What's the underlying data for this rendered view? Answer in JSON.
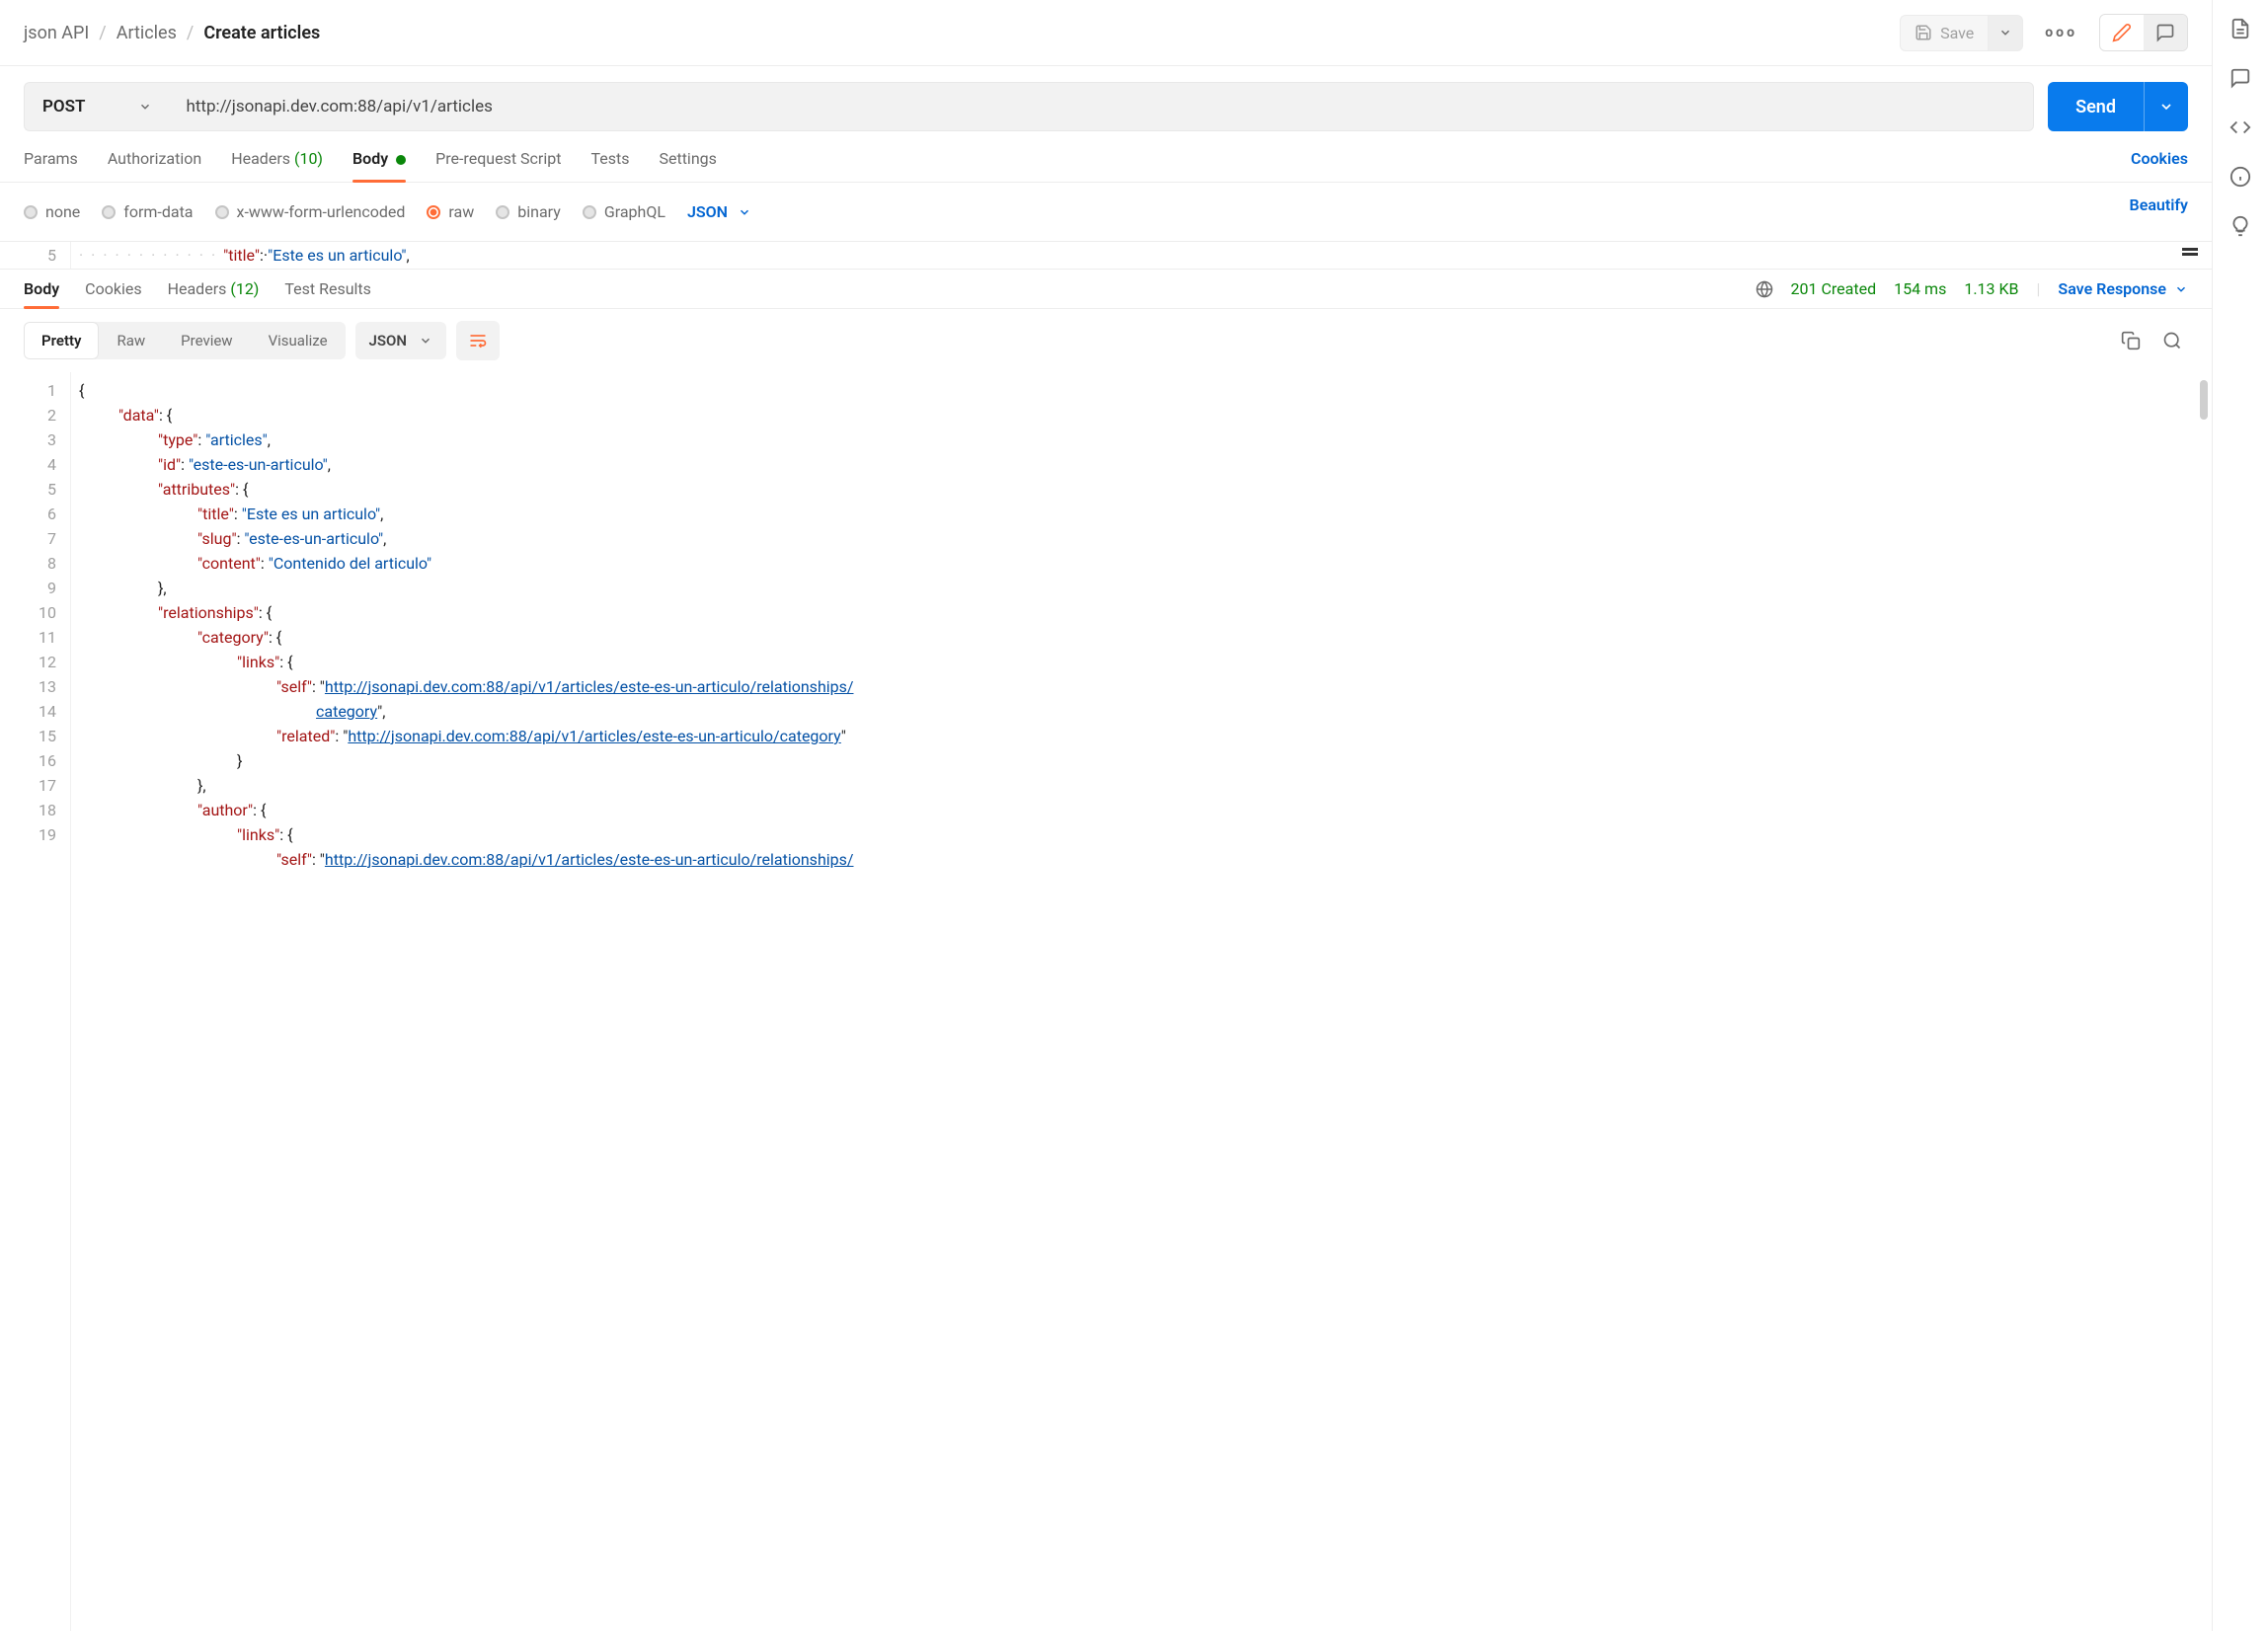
{
  "breadcrumbs": {
    "root": "json API",
    "mid": "Articles",
    "current": "Create articles"
  },
  "topbar": {
    "save": "Save",
    "more": "ooo"
  },
  "request": {
    "method": "POST",
    "url": "http://jsonapi.dev.com:88/api/v1/articles",
    "send": "Send"
  },
  "reqTabs": {
    "params": "Params",
    "auth": "Authorization",
    "headers": "Headers",
    "headersCount": "(10)",
    "body": "Body",
    "prereq": "Pre-request Script",
    "tests": "Tests",
    "settings": "Settings",
    "cookies": "Cookies"
  },
  "bodyTypes": {
    "none": "none",
    "formdata": "form-data",
    "urlenc": "x-www-form-urlencoded",
    "raw": "raw",
    "binary": "binary",
    "graphql": "GraphQL",
    "format": "JSON",
    "beautify": "Beautify"
  },
  "reqEditor": {
    "lineNo": "5",
    "key": "\"title\"",
    "val": "\"Este es un articulo\""
  },
  "respTabs": {
    "body": "Body",
    "cookies": "Cookies",
    "headers": "Headers",
    "headersCount": "(12)",
    "testResults": "Test Results"
  },
  "respMeta": {
    "status": "201 Created",
    "time": "154 ms",
    "size": "1.13 KB",
    "save": "Save Response"
  },
  "viewModes": {
    "pretty": "Pretty",
    "raw": "Raw",
    "preview": "Preview",
    "visualize": "Visualize",
    "format": "JSON"
  },
  "responseLines": [
    {
      "n": "1",
      "pad": 0,
      "tok": [
        {
          "t": "p",
          "v": "{"
        }
      ]
    },
    {
      "n": "2",
      "pad": 1,
      "tok": [
        {
          "t": "k",
          "v": "\"data\""
        },
        {
          "t": "p",
          "v": ": {"
        }
      ]
    },
    {
      "n": "3",
      "pad": 2,
      "tok": [
        {
          "t": "k",
          "v": "\"type\""
        },
        {
          "t": "p",
          "v": ": "
        },
        {
          "t": "s",
          "v": "\"articles\""
        },
        {
          "t": "p",
          "v": ","
        }
      ]
    },
    {
      "n": "4",
      "pad": 2,
      "tok": [
        {
          "t": "k",
          "v": "\"id\""
        },
        {
          "t": "p",
          "v": ": "
        },
        {
          "t": "s",
          "v": "\"este-es-un-articulo\""
        },
        {
          "t": "p",
          "v": ","
        }
      ]
    },
    {
      "n": "5",
      "pad": 2,
      "tok": [
        {
          "t": "k",
          "v": "\"attributes\""
        },
        {
          "t": "p",
          "v": ": {"
        }
      ]
    },
    {
      "n": "6",
      "pad": 3,
      "tok": [
        {
          "t": "k",
          "v": "\"title\""
        },
        {
          "t": "p",
          "v": ": "
        },
        {
          "t": "s",
          "v": "\"Este es un articulo\""
        },
        {
          "t": "p",
          "v": ","
        }
      ]
    },
    {
      "n": "7",
      "pad": 3,
      "tok": [
        {
          "t": "k",
          "v": "\"slug\""
        },
        {
          "t": "p",
          "v": ": "
        },
        {
          "t": "s",
          "v": "\"este-es-un-articulo\""
        },
        {
          "t": "p",
          "v": ","
        }
      ]
    },
    {
      "n": "8",
      "pad": 3,
      "tok": [
        {
          "t": "k",
          "v": "\"content\""
        },
        {
          "t": "p",
          "v": ": "
        },
        {
          "t": "s",
          "v": "\"Contenido del articulo\""
        }
      ]
    },
    {
      "n": "9",
      "pad": 2,
      "tok": [
        {
          "t": "p",
          "v": "},"
        }
      ]
    },
    {
      "n": "10",
      "pad": 2,
      "tok": [
        {
          "t": "k",
          "v": "\"relationships\""
        },
        {
          "t": "p",
          "v": ": {"
        }
      ]
    },
    {
      "n": "11",
      "pad": 3,
      "tok": [
        {
          "t": "k",
          "v": "\"category\""
        },
        {
          "t": "p",
          "v": ": {"
        }
      ]
    },
    {
      "n": "12",
      "pad": 4,
      "tok": [
        {
          "t": "k",
          "v": "\"links\""
        },
        {
          "t": "p",
          "v": ": {"
        }
      ]
    },
    {
      "n": "13",
      "pad": 5,
      "tok": [
        {
          "t": "k",
          "v": "\"self\""
        },
        {
          "t": "p",
          "v": ": \""
        },
        {
          "t": "l",
          "v": "http://jsonapi.dev.com:88/api/v1/articles/este-es-un-articulo/relationships/"
        }
      ]
    },
    {
      "n": "",
      "pad": 6,
      "tok": [
        {
          "t": "l",
          "v": "category"
        },
        {
          "t": "p",
          "v": "\","
        }
      ]
    },
    {
      "n": "14",
      "pad": 5,
      "tok": [
        {
          "t": "k",
          "v": "\"related\""
        },
        {
          "t": "p",
          "v": ": \""
        },
        {
          "t": "l",
          "v": "http://jsonapi.dev.com:88/api/v1/articles/este-es-un-articulo/category"
        },
        {
          "t": "p",
          "v": "\""
        }
      ]
    },
    {
      "n": "15",
      "pad": 4,
      "tok": [
        {
          "t": "p",
          "v": "}"
        }
      ]
    },
    {
      "n": "16",
      "pad": 3,
      "tok": [
        {
          "t": "p",
          "v": "},"
        }
      ]
    },
    {
      "n": "17",
      "pad": 3,
      "tok": [
        {
          "t": "k",
          "v": "\"author\""
        },
        {
          "t": "p",
          "v": ": {"
        }
      ]
    },
    {
      "n": "18",
      "pad": 4,
      "tok": [
        {
          "t": "k",
          "v": "\"links\""
        },
        {
          "t": "p",
          "v": ": {"
        }
      ]
    },
    {
      "n": "19",
      "pad": 5,
      "tok": [
        {
          "t": "k",
          "v": "\"self\""
        },
        {
          "t": "p",
          "v": ": \""
        },
        {
          "t": "l",
          "v": "http://jsonapi.dev.com:88/api/v1/articles/este-es-un-articulo/relationships/"
        }
      ]
    }
  ]
}
